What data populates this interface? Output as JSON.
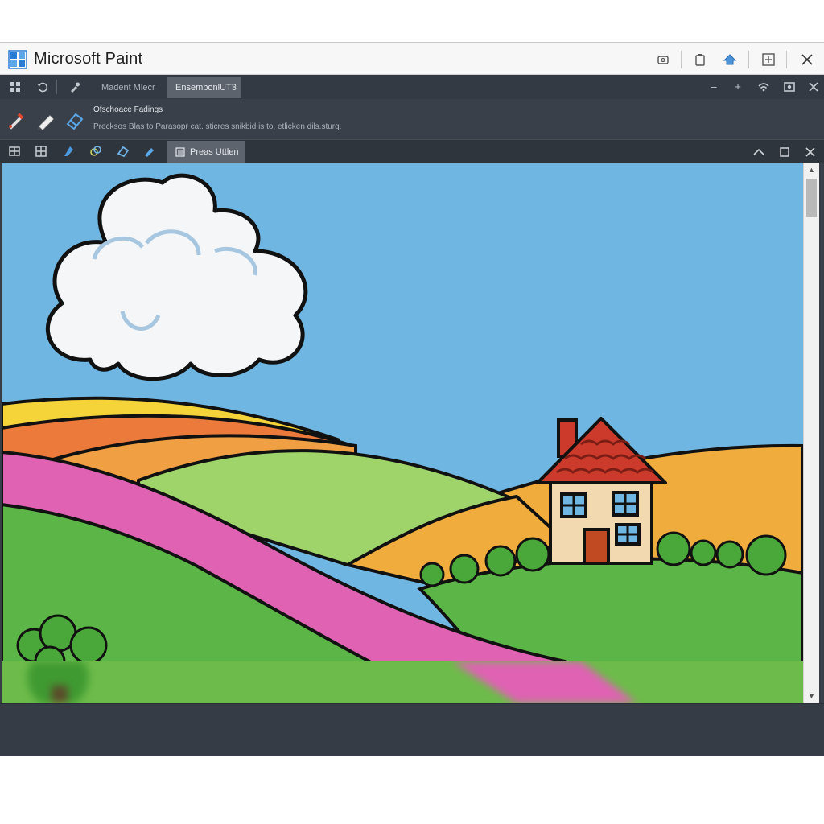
{
  "app": {
    "title": "Microsoft Paint",
    "accent": "#2b7cd3"
  },
  "titlebar": {
    "buttons": [
      "screenshot-icon",
      "clipboard-icon",
      "share-icon",
      "new-window-icon",
      "close-icon"
    ]
  },
  "menubar": {
    "tabs": [
      {
        "label": "Madent Mlecr",
        "active": false
      },
      {
        "label": "EnsembonlUT3",
        "active": true
      }
    ],
    "window_controls": [
      "minimize-icon",
      "pin-icon",
      "wifi-icon",
      "record-icon",
      "close-icon"
    ]
  },
  "tool_panel": {
    "heading": "Ofschoace Fadings",
    "description": "Precksos Blas to Parasopr cat. sticres snikbid is to, etlicken dils.sturg."
  },
  "doc_tabs": {
    "active_label": "Preas Uttlen",
    "controls": [
      "collapse-icon",
      "maximize-icon",
      "close-icon"
    ]
  },
  "canvas": {
    "sky_color": "#6fb7e2",
    "grass_color": "#5cb547",
    "path_color": "#df62b3",
    "roof_color": "#cc3a2c"
  },
  "statusbar": {
    "text": ""
  }
}
